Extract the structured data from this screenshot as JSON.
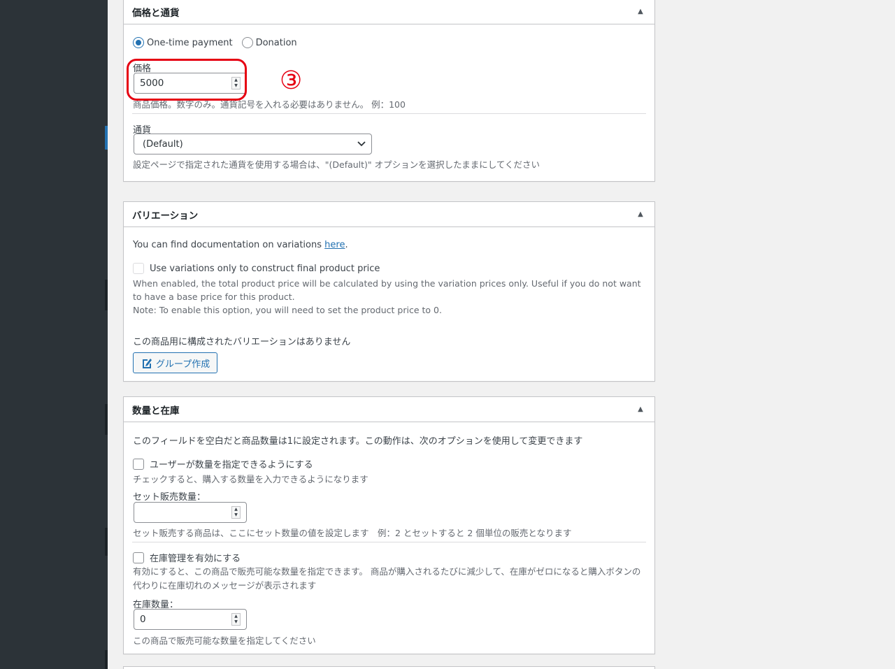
{
  "box_price": {
    "title": "価格と通貨",
    "toggle": "▲",
    "radio_onetime": "One-time payment",
    "radio_donation": "Donation",
    "price_label": "価格",
    "price_value": "5000",
    "price_help": "商品価格。数字のみ。通貨記号を入れる必要はありません。 例：100",
    "currency_label": "通貨",
    "currency_value": "(Default)",
    "currency_help": "設定ページで指定された通貨を使用する場合は、\"(Default)\" オプションを選択したままにしてください"
  },
  "box_variation": {
    "title": "バリエーション",
    "toggle": "▲",
    "doc_text": "You can find documentation on variations ",
    "doc_link": "here",
    "doc_period": ".",
    "only_variations_label": "Use variations only to construct final product price",
    "only_variations_help1": "When enabled, the total product price will be calculated by using the variation prices only. Useful if you do not want to have a base price for this product.",
    "only_variations_help2": "Note: To enable this option, you will need to set the product price to 0.",
    "no_variations": "この商品用に構成されたバリエーションはありません",
    "create_group_button": "グループ作成"
  },
  "box_stock": {
    "title": "数量と在庫",
    "toggle": "▲",
    "intro": "このフィールドを空白だと商品数量は1に設定されます。この動作は、次のオプションを使用して変更できます",
    "user_qty_label": "ユーザーが数量を指定できるようにする",
    "user_qty_help": "チェックすると、購入する数量を入力できるようになります",
    "set_qty_label": "セット販売数量：",
    "set_qty_value": "",
    "set_qty_help": "セット販売する商品は、ここにセット数量の値を設定します　例：2 とセットすると 2 個単位の販売となります",
    "stock_enable_label": "在庫管理を有効にする",
    "stock_enable_help": "有効にすると、この商品で販売可能な数量を指定できます。 商品が購入されるたびに減少して、在庫がゼロになると購入ボタンの代わりに在庫切れのメッセージが表示されます",
    "stock_qty_label": "在庫数量：",
    "stock_qty_value": "0",
    "stock_qty_help": "この商品で販売可能な数量を指定してください"
  },
  "annotation": {
    "number": "③",
    "color": "#e60012"
  },
  "colors": {
    "accent": "#2271b1",
    "sidebar": "#2c3338"
  }
}
